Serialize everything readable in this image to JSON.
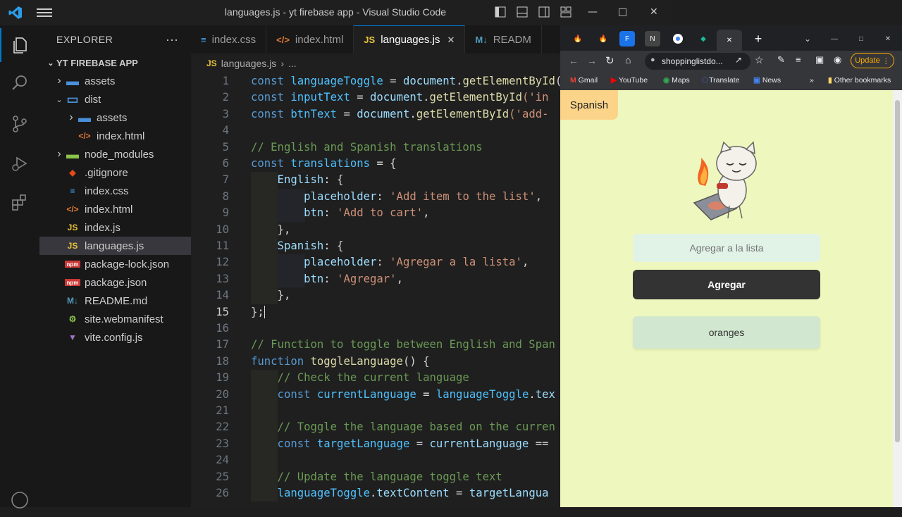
{
  "window": {
    "title": "languages.js - yt firebase app - Visual Studio Code"
  },
  "activity_bar": [
    "explorer-icon",
    "search-icon",
    "source-control-icon",
    "run-debug-icon",
    "extensions-icon",
    "account-icon"
  ],
  "explorer": {
    "header": "EXPLORER",
    "project": "YT FIREBASE APP",
    "items": [
      {
        "label": "assets",
        "kind": "folder",
        "depth": 1,
        "chev": "closed"
      },
      {
        "label": "dist",
        "kind": "folder-open",
        "depth": 1,
        "chev": "open"
      },
      {
        "label": "assets",
        "kind": "folder",
        "depth": 2,
        "chev": "closed"
      },
      {
        "label": "index.html",
        "kind": "html",
        "depth": 2,
        "chev": ""
      },
      {
        "label": "node_modules",
        "kind": "node",
        "depth": 1,
        "chev": "closed"
      },
      {
        "label": ".gitignore",
        "kind": "git",
        "depth": 1,
        "chev": ""
      },
      {
        "label": "index.css",
        "kind": "css",
        "depth": 1,
        "chev": ""
      },
      {
        "label": "index.html",
        "kind": "html",
        "depth": 1,
        "chev": ""
      },
      {
        "label": "index.js",
        "kind": "js",
        "depth": 1,
        "chev": ""
      },
      {
        "label": "languages.js",
        "kind": "js",
        "depth": 1,
        "chev": "",
        "selected": true
      },
      {
        "label": "package-lock.json",
        "kind": "npm",
        "depth": 1,
        "chev": ""
      },
      {
        "label": "package.json",
        "kind": "npm",
        "depth": 1,
        "chev": ""
      },
      {
        "label": "README.md",
        "kind": "md",
        "depth": 1,
        "chev": ""
      },
      {
        "label": "site.webmanifest",
        "kind": "manifest",
        "depth": 1,
        "chev": ""
      },
      {
        "label": "vite.config.js",
        "kind": "vite",
        "depth": 1,
        "chev": ""
      }
    ]
  },
  "tabs": [
    {
      "label": "index.css",
      "icon": "css"
    },
    {
      "label": "index.html",
      "icon": "html"
    },
    {
      "label": "languages.js",
      "icon": "js",
      "active": true
    },
    {
      "label": "READM",
      "icon": "md"
    }
  ],
  "breadcrumb": {
    "file": "languages.js",
    "rest": "..."
  },
  "code": [
    {
      "n": 1,
      "indent": 0,
      "tokens": [
        [
          "const ",
          "#569cd6"
        ],
        [
          "languageToggle",
          "#4fc1ff"
        ],
        [
          " = ",
          "#d4d4d4"
        ],
        [
          "document",
          "#9cdcfe"
        ],
        [
          ".",
          "#d4d4d4"
        ],
        [
          "getElementById",
          "#dcdcaa"
        ],
        [
          "(",
          "#d4d4d4"
        ]
      ]
    },
    {
      "n": 2,
      "indent": 0,
      "tokens": [
        [
          "const ",
          "#569cd6"
        ],
        [
          "inputText",
          "#4fc1ff"
        ],
        [
          " = ",
          "#d4d4d4"
        ],
        [
          "document",
          "#9cdcfe"
        ],
        [
          ".",
          "#d4d4d4"
        ],
        [
          "getElementById",
          "#dcdcaa"
        ],
        [
          "('in",
          "#ce9178"
        ]
      ]
    },
    {
      "n": 3,
      "indent": 0,
      "tokens": [
        [
          "const ",
          "#569cd6"
        ],
        [
          "btnText",
          "#4fc1ff"
        ],
        [
          " = ",
          "#d4d4d4"
        ],
        [
          "document",
          "#9cdcfe"
        ],
        [
          ".",
          "#d4d4d4"
        ],
        [
          "getElementById",
          "#dcdcaa"
        ],
        [
          "('add-",
          "#ce9178"
        ]
      ]
    },
    {
      "n": 4,
      "indent": 0,
      "tokens": []
    },
    {
      "n": 5,
      "indent": 0,
      "tokens": [
        [
          "// English and Spanish translations",
          "#6a9955"
        ]
      ]
    },
    {
      "n": 6,
      "indent": 0,
      "tokens": [
        [
          "const ",
          "#569cd6"
        ],
        [
          "translations",
          "#4fc1ff"
        ],
        [
          " = {",
          "#d4d4d4"
        ]
      ]
    },
    {
      "n": 7,
      "indent": 1,
      "tokens": [
        [
          "    English",
          "#9cdcfe"
        ],
        [
          ": {",
          "#d4d4d4"
        ]
      ]
    },
    {
      "n": 8,
      "indent": 2,
      "tokens": [
        [
          "        placeholder",
          "#9cdcfe"
        ],
        [
          ": ",
          "#d4d4d4"
        ],
        [
          "'Add item to the list'",
          "#ce9178"
        ],
        [
          ",",
          "#d4d4d4"
        ]
      ]
    },
    {
      "n": 9,
      "indent": 2,
      "tokens": [
        [
          "        btn",
          "#9cdcfe"
        ],
        [
          ": ",
          "#d4d4d4"
        ],
        [
          "'Add to cart'",
          "#ce9178"
        ],
        [
          ",",
          "#d4d4d4"
        ]
      ]
    },
    {
      "n": 10,
      "indent": 1,
      "tokens": [
        [
          "    },",
          "#d4d4d4"
        ]
      ]
    },
    {
      "n": 11,
      "indent": 1,
      "tokens": [
        [
          "    Spanish",
          "#9cdcfe"
        ],
        [
          ": {",
          "#d4d4d4"
        ]
      ]
    },
    {
      "n": 12,
      "indent": 2,
      "tokens": [
        [
          "        placeholder",
          "#9cdcfe"
        ],
        [
          ": ",
          "#d4d4d4"
        ],
        [
          "'Agregar a la lista'",
          "#ce9178"
        ],
        [
          ",",
          "#d4d4d4"
        ]
      ]
    },
    {
      "n": 13,
      "indent": 2,
      "tokens": [
        [
          "        btn",
          "#9cdcfe"
        ],
        [
          ": ",
          "#d4d4d4"
        ],
        [
          "'Agregar'",
          "#ce9178"
        ],
        [
          ",",
          "#d4d4d4"
        ]
      ]
    },
    {
      "n": 14,
      "indent": 1,
      "tokens": [
        [
          "    },",
          "#d4d4d4"
        ]
      ]
    },
    {
      "n": 15,
      "indent": 0,
      "current": true,
      "tokens": [
        [
          "};",
          "#d4d4d4"
        ]
      ]
    },
    {
      "n": 16,
      "indent": 0,
      "tokens": []
    },
    {
      "n": 17,
      "indent": 0,
      "tokens": [
        [
          "// Function to toggle between English and Span",
          "#6a9955"
        ]
      ]
    },
    {
      "n": 18,
      "indent": 0,
      "tokens": [
        [
          "function ",
          "#569cd6"
        ],
        [
          "toggleLanguage",
          "#dcdcaa"
        ],
        [
          "() {",
          "#d4d4d4"
        ]
      ]
    },
    {
      "n": 19,
      "indent": 1,
      "tokens": [
        [
          "    // Check the current language",
          "#6a9955"
        ]
      ]
    },
    {
      "n": 20,
      "indent": 1,
      "tokens": [
        [
          "    const ",
          "#569cd6"
        ],
        [
          "currentLanguage",
          "#4fc1ff"
        ],
        [
          " = ",
          "#d4d4d4"
        ],
        [
          "languageToggle",
          "#4fc1ff"
        ],
        [
          ".",
          "#d4d4d4"
        ],
        [
          "tex",
          "#9cdcfe"
        ]
      ]
    },
    {
      "n": 21,
      "indent": 1,
      "tokens": []
    },
    {
      "n": 22,
      "indent": 1,
      "tokens": [
        [
          "    // Toggle the language based on the curren",
          "#6a9955"
        ]
      ]
    },
    {
      "n": 23,
      "indent": 1,
      "tokens": [
        [
          "    const ",
          "#569cd6"
        ],
        [
          "targetLanguage",
          "#4fc1ff"
        ],
        [
          " = ",
          "#d4d4d4"
        ],
        [
          "currentLanguage",
          "#9cdcfe"
        ],
        [
          " ==",
          "#d4d4d4"
        ]
      ]
    },
    {
      "n": 24,
      "indent": 1,
      "tokens": []
    },
    {
      "n": 25,
      "indent": 1,
      "tokens": [
        [
          "    // Update the language toggle text",
          "#6a9955"
        ]
      ]
    },
    {
      "n": 26,
      "indent": 1,
      "tokens": [
        [
          "    languageToggle",
          "#4fc1ff"
        ],
        [
          ".",
          "#d4d4d4"
        ],
        [
          "textContent",
          "#9cdcfe"
        ],
        [
          " = ",
          "#d4d4d4"
        ],
        [
          "targetLangua",
          "#9cdcfe"
        ]
      ]
    }
  ],
  "browser": {
    "url": "shoppinglistdo...",
    "update_label": "Update",
    "bookmarks": [
      "Gmail",
      "YouTube",
      "Maps",
      "Translate",
      "News",
      "»",
      "Other bookmarks"
    ]
  },
  "app": {
    "lang_button": "Spanish",
    "input_placeholder": "Agregar a la lista",
    "add_button": "Agregar",
    "list_items": [
      "oranges"
    ]
  },
  "colors": {
    "accent": "#0078d4",
    "page_bg": "#eef7bd",
    "lang_btn": "#fbd48a",
    "add_btn": "#333333",
    "item_bg": "#d2e7cf"
  }
}
